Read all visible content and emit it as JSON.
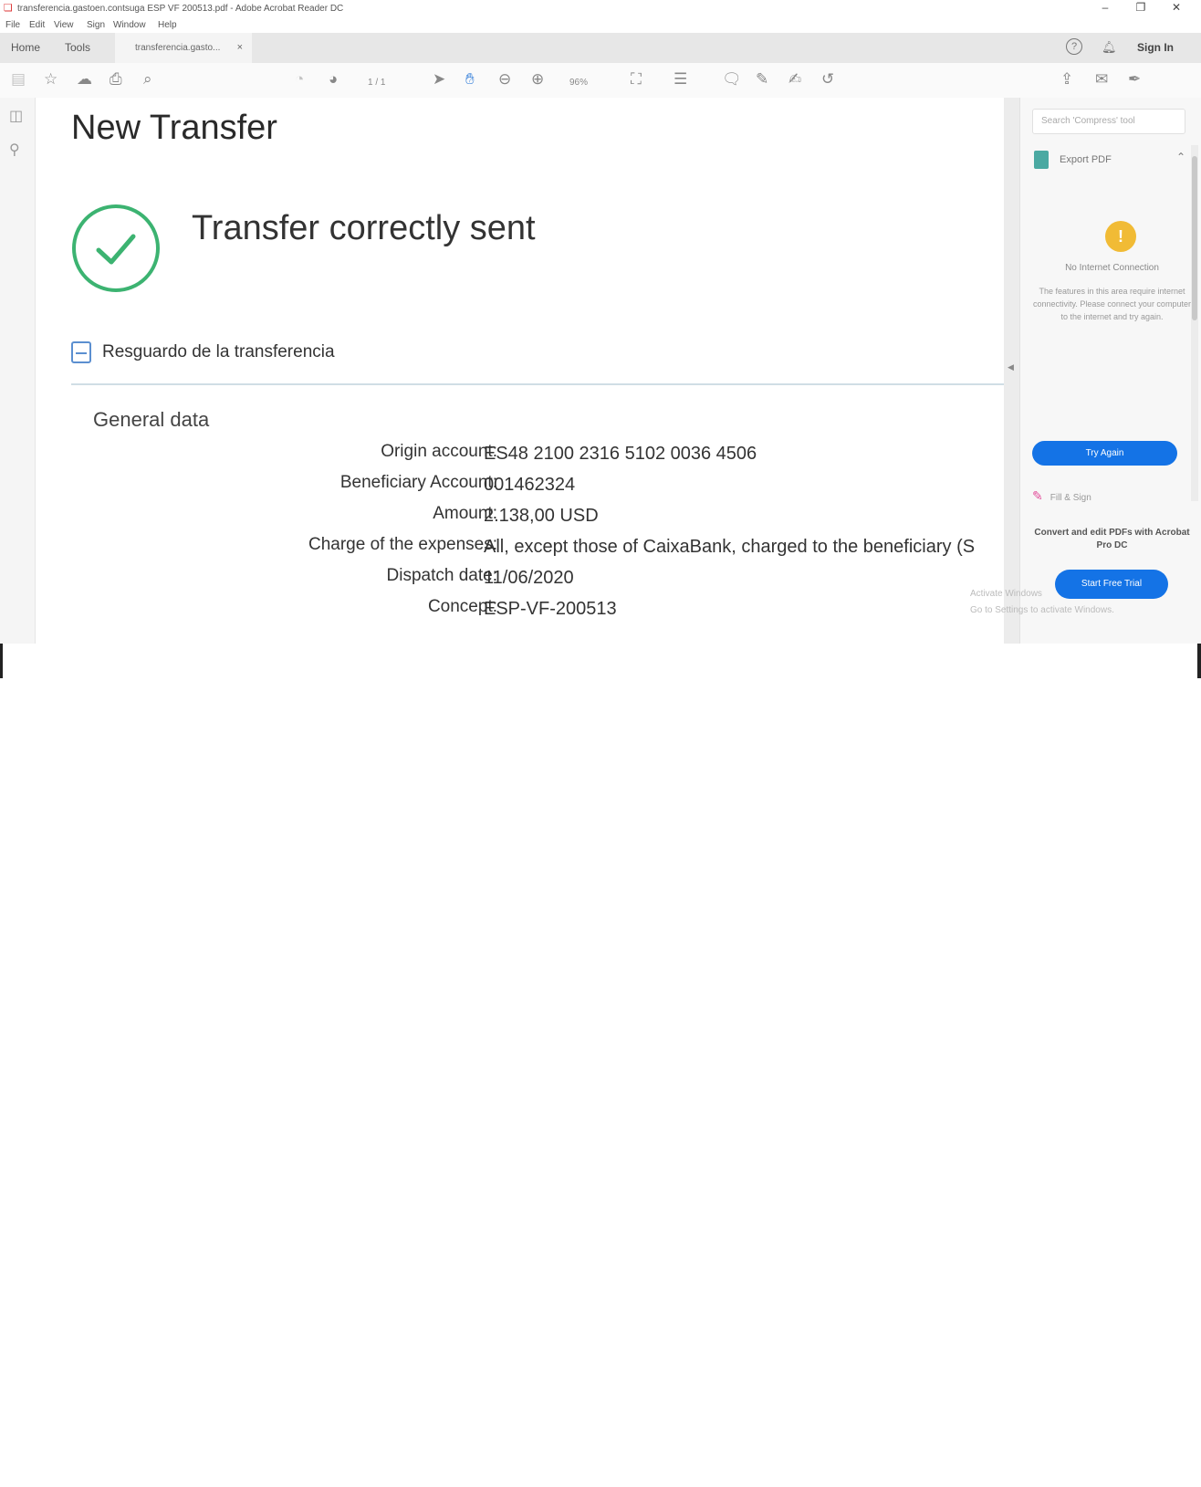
{
  "window": {
    "title": "transferencia.gastoen.contsuga ESP VF 200513.pdf - Adobe Acrobat Reader DC",
    "controls": [
      "–",
      "❐",
      "✕"
    ]
  },
  "menu": [
    "File",
    "Edit",
    "View",
    "Sign",
    "Window",
    "Help"
  ],
  "tabs": {
    "home": "Home",
    "tools": "Tools",
    "document": "transferencia.gasto...",
    "close": "×"
  },
  "header_right": {
    "help": "?",
    "signin": "Sign In"
  },
  "toolbar": {
    "page_nav": "1 / 1",
    "zoom": "96%"
  },
  "document": {
    "title": "New Transfer",
    "status": "Transfer correctly sent",
    "receipt_link": "Resguardo de la transferencia",
    "section": "General data",
    "fields": [
      {
        "label": "Origin account:",
        "value": "ES48 2100 2316 5102 0036 4506"
      },
      {
        "label": "Beneficiary Account:",
        "value": "001462324"
      },
      {
        "label": "Amount:",
        "value": "2.138,00 USD"
      },
      {
        "label": "Charge of the expenses:",
        "value": "All, except those of CaixaBank, charged to the beneficiary (S"
      },
      {
        "label": "Dispatch date:",
        "value": "11/06/2020"
      },
      {
        "label": "Concept:",
        "value": "ESP-VF-200513"
      }
    ]
  },
  "right_panel": {
    "search_placeholder": "Search 'Compress' tool",
    "export_label": "Export PDF",
    "no_connection_title": "No Internet Connection",
    "no_connection_message": "The features in this area require internet connectivity. Please connect your computer to the internet and try again.",
    "try_again": "Try Again",
    "fill_sign": "Fill & Sign",
    "promo": "Convert and edit PDFs with Acrobat Pro DC",
    "free_trial": "Start Free Trial",
    "watermark": [
      "Activate Windows",
      "Go to Settings to activate Windows."
    ]
  },
  "colors": {
    "accent": "#1473e6",
    "success": "#3cb371",
    "warning": "#f1bb35"
  }
}
